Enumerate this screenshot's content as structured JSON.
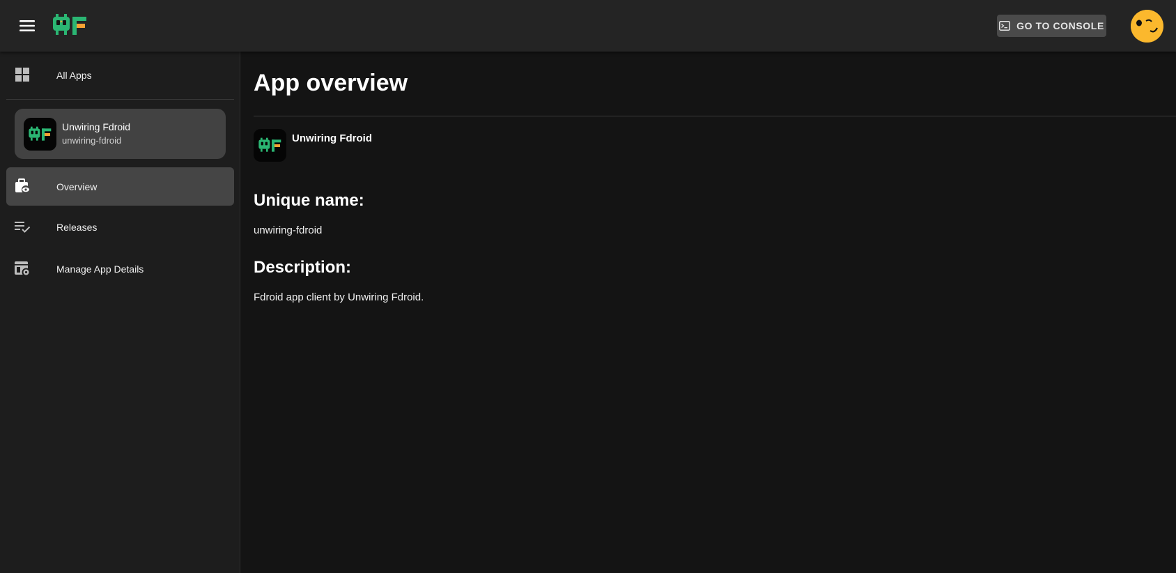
{
  "header": {
    "console_button_label": "GO TO CONSOLE"
  },
  "sidebar": {
    "all_apps_label": "All Apps",
    "selected_app": {
      "name": "Unwiring Fdroid",
      "slug": "unwiring-fdroid"
    },
    "items": [
      {
        "label": "Overview",
        "icon": "overview-icon",
        "active": true
      },
      {
        "label": "Releases",
        "icon": "playlist-check-icon",
        "active": false
      },
      {
        "label": "Manage App Details",
        "icon": "app-settings-icon",
        "active": false
      }
    ]
  },
  "main": {
    "title": "App overview",
    "app_name": "Unwiring Fdroid",
    "unique_name_heading": "Unique name:",
    "unique_name_value": "unwiring-fdroid",
    "description_heading": "Description:",
    "description_value": "Fdroid app client by Unwiring Fdroid."
  },
  "colors": {
    "logo_green": "#2bb673",
    "logo_orange": "#f7a233",
    "avatar_yellow": "#fbb82d",
    "active_item_bg": "#454545"
  }
}
